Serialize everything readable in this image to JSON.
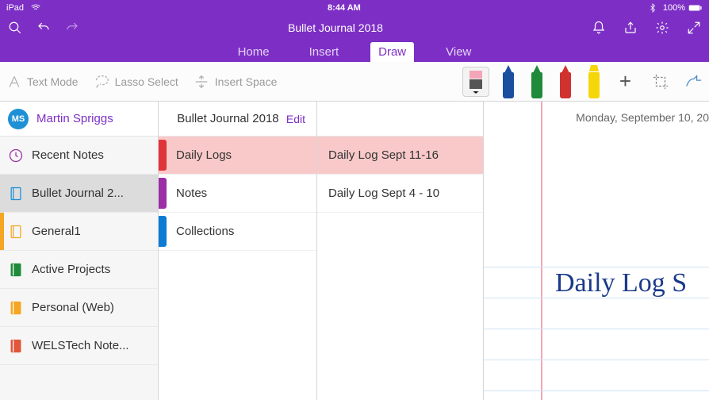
{
  "statusbar": {
    "device": "iPad",
    "time": "8:44 AM",
    "battery": "100%"
  },
  "header": {
    "title": "Bullet Journal 2018",
    "tabs": [
      {
        "label": "Home"
      },
      {
        "label": "Insert"
      },
      {
        "label": "Draw",
        "active": true
      },
      {
        "label": "View"
      }
    ]
  },
  "toolbar": {
    "text_mode": "Text Mode",
    "lasso": "Lasso Select",
    "insert_space": "Insert Space",
    "pens": [
      {
        "color": "#1a4fa0"
      },
      {
        "color": "#1e8a3a"
      },
      {
        "color": "#d0332f"
      },
      {
        "color": "#f5d60a",
        "highlighter": true
      }
    ]
  },
  "user": {
    "initials": "MS",
    "name": "Martin Spriggs"
  },
  "notebooks": [
    {
      "label": "Recent Notes",
      "icon": "clock",
      "color": "#9b2fa5"
    },
    {
      "label": "Bullet Journal 2...",
      "icon": "book",
      "color": "#1e90d6",
      "active": true
    },
    {
      "label": "General1",
      "icon": "book",
      "color": "#f5a623",
      "orangeTab": true
    },
    {
      "label": "Active Projects",
      "icon": "book",
      "color": "#1e8a3a"
    },
    {
      "label": "Personal (Web)",
      "icon": "book",
      "color": "#f5a623"
    },
    {
      "label": "WELSTech Note...",
      "icon": "book",
      "color": "#e0573b"
    }
  ],
  "sections": {
    "title": "Bullet Journal 2018",
    "edit": "Edit",
    "items": [
      {
        "label": "Daily Logs",
        "colorClass": "c-red",
        "active": true
      },
      {
        "label": "Notes",
        "colorClass": "c-purple"
      },
      {
        "label": "Collections",
        "colorClass": "c-blue"
      }
    ]
  },
  "pages": [
    {
      "label": "Daily Log Sept 11-16",
      "active": true
    },
    {
      "label": "Daily Log Sept 4 - 10"
    }
  ],
  "canvas": {
    "date": "Monday, September 10, 20",
    "handwriting": "Daily Log S"
  }
}
